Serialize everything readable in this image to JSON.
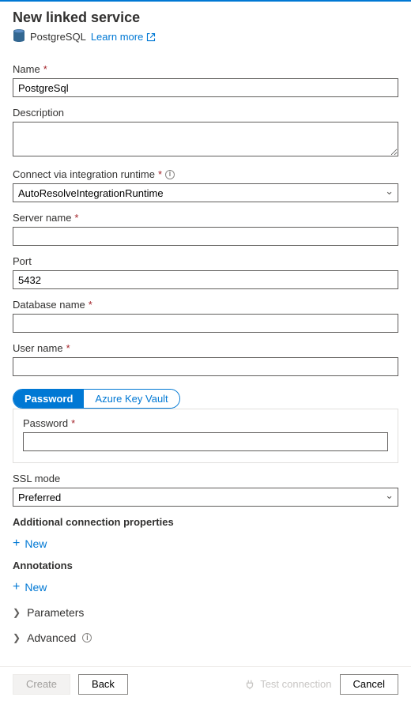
{
  "header": {
    "title": "New linked service",
    "service_type": "PostgreSQL",
    "learn_more": "Learn more"
  },
  "fields": {
    "name": {
      "label": "Name",
      "required": true,
      "value": "PostgreSql"
    },
    "description": {
      "label": "Description",
      "required": false,
      "value": ""
    },
    "runtime": {
      "label": "Connect via integration runtime",
      "required": true,
      "value": "AutoResolveIntegrationRuntime"
    },
    "server": {
      "label": "Server name",
      "required": true,
      "value": ""
    },
    "port": {
      "label": "Port",
      "required": false,
      "value": "5432"
    },
    "database": {
      "label": "Database name",
      "required": true,
      "value": ""
    },
    "username": {
      "label": "User name",
      "required": true,
      "value": ""
    },
    "password_toggle": {
      "options": [
        "Password",
        "Azure Key Vault"
      ],
      "active": 0
    },
    "password": {
      "label": "Password",
      "required": true,
      "value": ""
    },
    "ssl": {
      "label": "SSL mode",
      "required": false,
      "value": "Preferred"
    }
  },
  "sections": {
    "additional_props": {
      "label": "Additional connection properties",
      "new_label": "New"
    },
    "annotations": {
      "label": "Annotations",
      "new_label": "New"
    },
    "parameters": {
      "label": "Parameters"
    },
    "advanced": {
      "label": "Advanced"
    }
  },
  "footer": {
    "create": "Create",
    "back": "Back",
    "test_connection": "Test connection",
    "cancel": "Cancel"
  }
}
